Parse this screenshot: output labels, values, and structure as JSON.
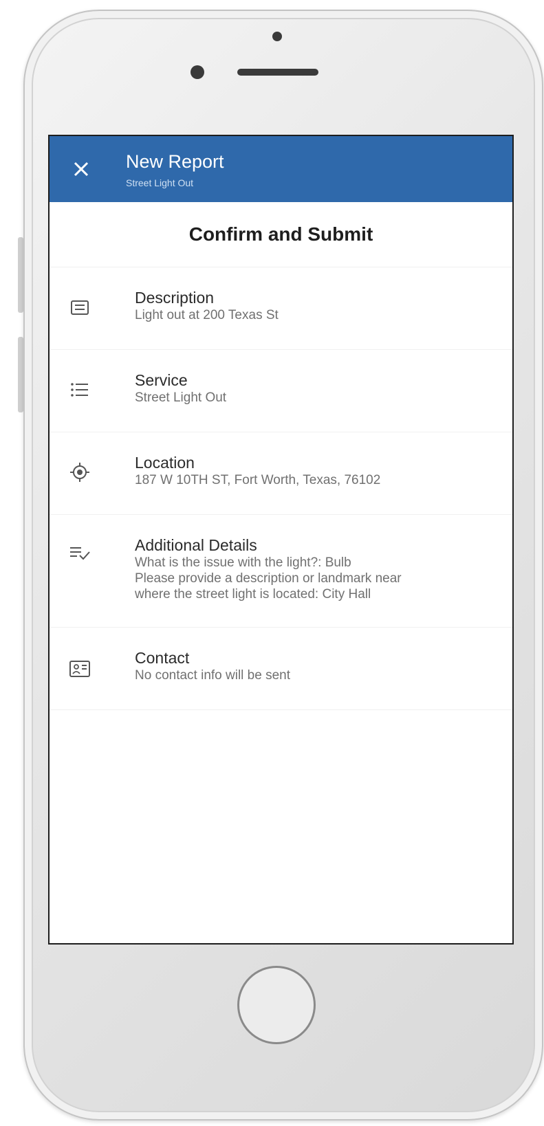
{
  "appbar": {
    "close_icon": "close-icon",
    "title": "New Report",
    "subtitle": "Street Light Out"
  },
  "page": {
    "heading": "Confirm and Submit"
  },
  "rows": [
    {
      "icon": "description-icon",
      "label": "Description",
      "value": "Light out at 200 Texas St"
    },
    {
      "icon": "list-icon",
      "label": "Service",
      "value": "Street Light Out"
    },
    {
      "icon": "location-target-icon",
      "label": "Location",
      "value": "187 W 10TH ST, Fort Worth, Texas, 76102"
    },
    {
      "icon": "checklist-icon",
      "label": "Additional Details",
      "value_lines": [
        "What is the issue with the light?: Bulb",
        "Please provide a description or landmark near",
        "where the street light is located: City Hall"
      ]
    },
    {
      "icon": "contact-card-icon",
      "label": "Contact",
      "value": "No contact info will be sent"
    }
  ],
  "colors": {
    "appbar": "#2f69ab",
    "heading_text": "#1e1e1e",
    "label_text": "#2b2b2b",
    "value_text": "#707070"
  }
}
